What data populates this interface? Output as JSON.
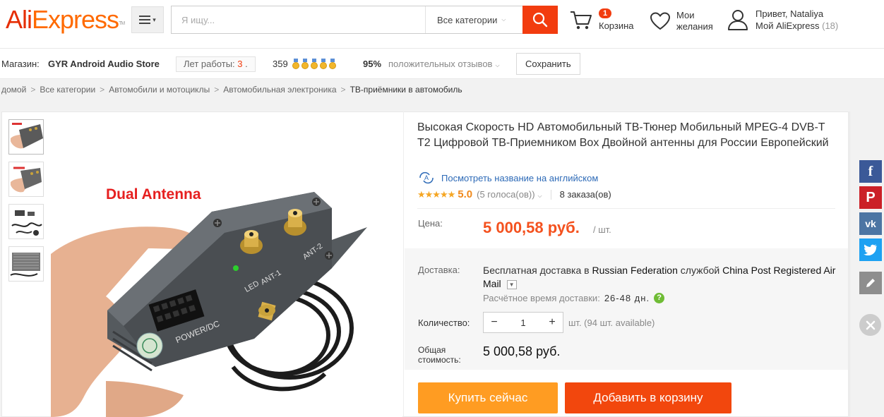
{
  "header": {
    "logo_ali": "Ali",
    "logo_express": "Express",
    "logo_tm": "TM",
    "search_placeholder": "Я ищу...",
    "search_category": "Все категории",
    "cart_count": "1",
    "cart_label": "Корзина",
    "wishlist_line1": "Мои",
    "wishlist_line2": "желания",
    "account_greeting": "Привет, Nataliya",
    "account_link": "Мой AliExpress",
    "account_count": "(18)"
  },
  "store": {
    "label": "Магазин:",
    "name": "GYR Android Audio Store",
    "years_label": "Лет работы:",
    "years_value": "3",
    "years_suffix": ".",
    "score": "359",
    "medal_count": 5,
    "positive_pct": "95%",
    "positive_label": "положительных отзывов",
    "save_label": "Сохранить"
  },
  "breadcrumb": {
    "items": [
      "домой",
      "Все категории",
      "Автомобили и мотоциклы",
      "Автомобильная электроника"
    ],
    "current": "ТВ-приёмники в автомобиль"
  },
  "gallery": {
    "image_caption": "Dual Antenna",
    "device_labels": {
      "power": "POWER/DC",
      "led": "LED",
      "ant1": "ANT-1",
      "ant2": "ANT-2"
    }
  },
  "product": {
    "title": "Высокая Скорость HD Автомобильный ТВ-Тюнер Мобильный MPEG-4 DVB-T T2 Цифровой ТВ-Приемником Box Двойной антенны для России Европейский",
    "translate_link": "Посмотреть название на английском",
    "rating_stars": "★★★★★",
    "rating_value": "5.0",
    "rating_votes": "(5 голоса(ов))",
    "orders": "8 заказа(ов)",
    "price_label": "Цена:",
    "price": "5 000,58 руб.",
    "price_unit": "/ шт.",
    "shipping_label": "Доставка:",
    "shipping_prefix": "Бесплатная доставка в",
    "shipping_country": "Russian Federation",
    "shipping_by": "службой",
    "shipping_method": "China Post Registered Air Mail",
    "eta_label": "Расчётное время доставки:",
    "eta_value": "26-48 дн.",
    "quantity_label": "Количество:",
    "quantity_value": "1",
    "quantity_avail": "шт. (94 шт. available)",
    "total_label": "Общая стоимость:",
    "total_value": "5 000,58 руб.",
    "buy_now": "Купить сейчас",
    "add_to_cart": "Добавить в корзину"
  },
  "social": {
    "items": [
      "facebook",
      "pinterest",
      "vk",
      "twitter",
      "edit"
    ]
  },
  "colors": {
    "brand_orange": "#f2470d",
    "buy_orange": "#ff9c22",
    "price_orange": "#f4511e",
    "link_blue": "#2d6ab7",
    "star_gold": "#f5a623"
  }
}
